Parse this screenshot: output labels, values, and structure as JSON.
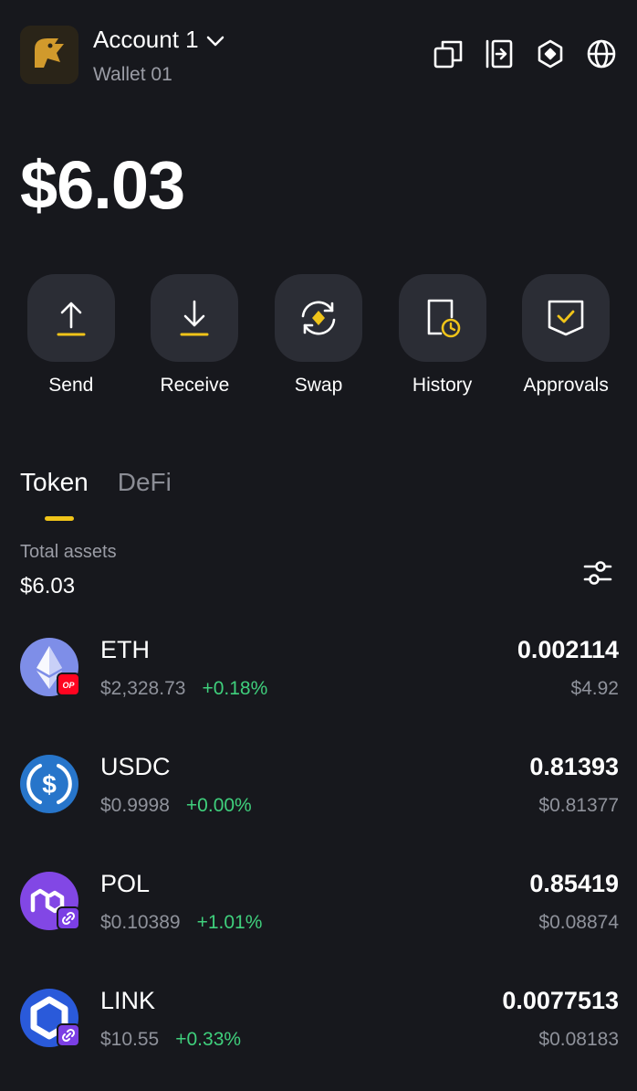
{
  "header": {
    "account_name": "Account 1",
    "wallet_name": "Wallet 01",
    "icons": [
      "copy-icon",
      "connect-icon",
      "web3-hex-icon",
      "globe-icon"
    ]
  },
  "balance": "$6.03",
  "actions": [
    {
      "label": "Send",
      "icon": "send-arrow-up-icon"
    },
    {
      "label": "Receive",
      "icon": "receive-arrow-down-icon"
    },
    {
      "label": "Swap",
      "icon": "swap-icon"
    },
    {
      "label": "History",
      "icon": "history-icon"
    },
    {
      "label": "Approvals",
      "icon": "shield-check-icon"
    }
  ],
  "tabs": [
    {
      "label": "Token",
      "active": true
    },
    {
      "label": "DeFi",
      "active": false
    }
  ],
  "total_assets": {
    "label": "Total assets",
    "value": "$6.03"
  },
  "tokens": [
    {
      "symbol": "ETH",
      "price": "$2,328.73",
      "change": "+0.18%",
      "amount": "0.002114",
      "value": "$4.92",
      "icon_color": "#7e8ee8",
      "badge": "OP"
    },
    {
      "symbol": "USDC",
      "price": "$0.9998",
      "change": "+0.00%",
      "amount": "0.81393",
      "value": "$0.81377",
      "icon_color": "#2775ca",
      "badge": ""
    },
    {
      "symbol": "POL",
      "price": "$0.10389",
      "change": "+1.01%",
      "amount": "0.85419",
      "value": "$0.08874",
      "icon_color": "#8247e5",
      "badge": "link"
    },
    {
      "symbol": "LINK",
      "price": "$10.55",
      "change": "+0.33%",
      "amount": "0.0077513",
      "value": "$0.08183",
      "icon_color": "#2a5ada",
      "badge": "link"
    }
  ],
  "colors": {
    "background": "#17181d",
    "button": "#2b2d35",
    "accent": "#f0c419",
    "positive": "#3fcf7c",
    "muted": "#8f929b"
  }
}
